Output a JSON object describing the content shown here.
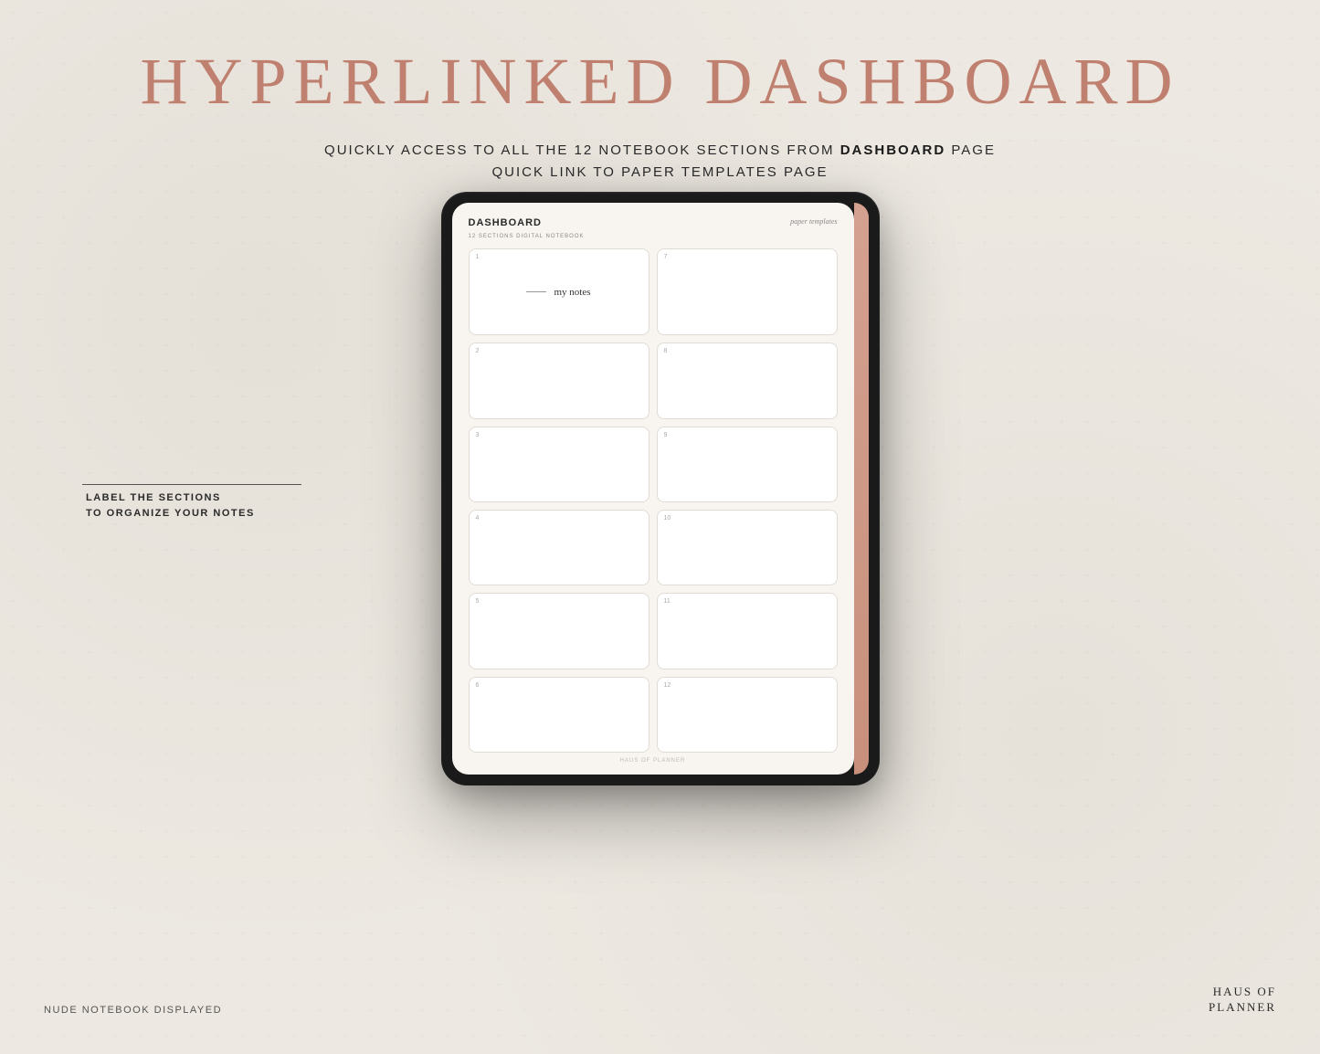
{
  "page": {
    "background_color": "#ede9e2",
    "main_title": "HYPERLINKED DASHBOARD",
    "subtitle_line1_prefix": "QUICKLY ACCESS TO ALL THE 12 NOTEBOOK SECTIONS FROM ",
    "subtitle_line1_bold": "DASHBOARD",
    "subtitle_line1_suffix": " PAGE",
    "subtitle_line2": "QUICK LINK TO PAPER TEMPLATES PAGE",
    "annotation_line1": "LABEL THE SECTIONS",
    "annotation_line2": "TO ORGANIZE YOUR NOTES",
    "bottom_left": "NUDE NOTEBOOK DISPLAYED",
    "brand_line1": "HAUS OF",
    "brand_line2": "PLANNER"
  },
  "tablet": {
    "dashboard_label": "DASHBOARD",
    "paper_templates_label": "paper templates",
    "notebook_subtitle": "12 SECTIONS DIGITAL NOTEBOOK",
    "footer_brand": "HAUS OF PLANNER",
    "sections": [
      {
        "number": "1",
        "label": "my notes",
        "has_label": true
      },
      {
        "number": "7",
        "label": "",
        "has_label": false
      },
      {
        "number": "2",
        "label": "",
        "has_label": false
      },
      {
        "number": "8",
        "label": "",
        "has_label": false
      },
      {
        "number": "3",
        "label": "",
        "has_label": false
      },
      {
        "number": "9",
        "label": "",
        "has_label": false
      },
      {
        "number": "4",
        "label": "",
        "has_label": false
      },
      {
        "number": "10",
        "label": "",
        "has_label": false
      },
      {
        "number": "5",
        "label": "",
        "has_label": false
      },
      {
        "number": "11",
        "label": "",
        "has_label": false
      },
      {
        "number": "6",
        "label": "",
        "has_label": false
      },
      {
        "number": "12",
        "label": "",
        "has_label": false
      }
    ]
  },
  "colors": {
    "title_color": "#c08070",
    "text_dark": "#2a2a2a",
    "text_muted": "#888888",
    "accent": "#c8907c"
  }
}
